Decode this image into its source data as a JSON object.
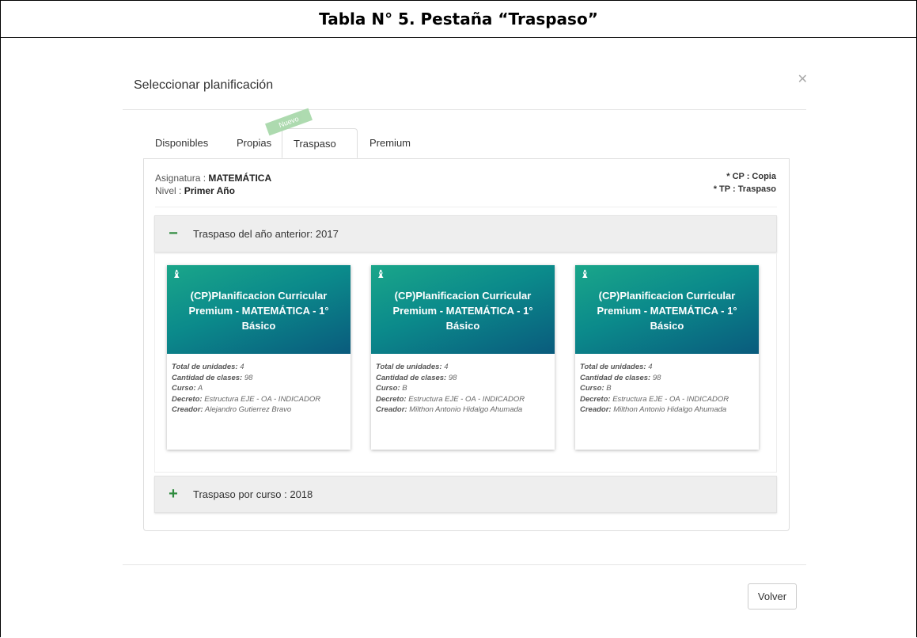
{
  "document": {
    "title": "Tabla N° 5. Pestaña “Traspaso”"
  },
  "modal": {
    "title": "Seleccionar planificación",
    "close_icon": "close-icon",
    "tabs": [
      {
        "label": "Disponibles",
        "active": false
      },
      {
        "label": "Propias",
        "active": false
      },
      {
        "label": "Traspaso",
        "active": true
      },
      {
        "label": "Premium",
        "active": false
      }
    ],
    "ribbon": "Nuevo",
    "info": {
      "asignatura_label": "Asignatura : ",
      "asignatura_value": "MATEMÁTICA",
      "nivel_label": "Nivel : ",
      "nivel_value": "Primer Año"
    },
    "legend": {
      "cp": "* CP : Copia",
      "tp": "* TP : Traspaso"
    },
    "accordion": [
      {
        "sign": "−",
        "label": "Traspaso del año anterior: 2017",
        "expanded": true
      },
      {
        "sign": "+",
        "label": "Traspaso por curso : 2018",
        "expanded": false
      }
    ],
    "cards": [
      {
        "icon": "stamp-icon",
        "title": "(CP)Planificacion Curricular Premium - MATEMÁTICA - 1° Básico",
        "unidades_label": "Total de unidades:",
        "unidades": "4",
        "clases_label": "Cantidad de clases:",
        "clases": "98",
        "curso_label": "Curso:",
        "curso": "A",
        "decreto_label": "Decreto:",
        "decreto": "Estructura EJE - OA - INDICADOR",
        "creador_label": "Creador:",
        "creador": "Alejandro Gutierrez Bravo"
      },
      {
        "icon": "stamp-icon",
        "title": "(CP)Planificacion Curricular Premium - MATEMÁTICA - 1° Básico",
        "unidades_label": "Total de unidades:",
        "unidades": "4",
        "clases_label": "Cantidad de clases:",
        "clases": "98",
        "curso_label": "Curso:",
        "curso": "B",
        "decreto_label": "Decreto:",
        "decreto": "Estructura EJE - OA - INDICADOR",
        "creador_label": "Creador:",
        "creador": "Milthon Antonio Hidalgo Ahumada"
      },
      {
        "icon": "stamp-icon",
        "title": "(CP)Planificacion Curricular Premium - MATEMÁTICA - 1° Básico",
        "unidades_label": "Total de unidades:",
        "unidades": "4",
        "clases_label": "Cantidad de clases:",
        "clases": "98",
        "curso_label": "Curso:",
        "curso": "B",
        "decreto_label": "Decreto:",
        "decreto": "Estructura EJE - OA - INDICADOR",
        "creador_label": "Creador:",
        "creador": "Milthon Antonio Hidalgo Ahumada"
      }
    ],
    "footer": {
      "back_label": "Volver"
    }
  }
}
